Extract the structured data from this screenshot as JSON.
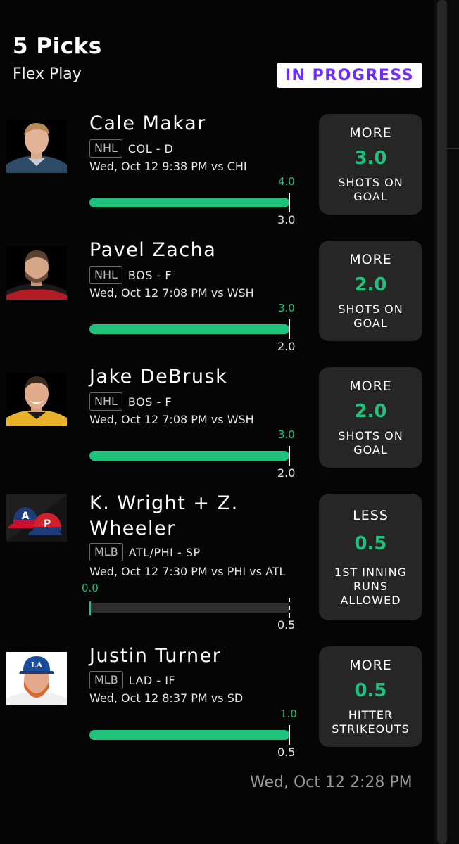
{
  "header": {
    "title": "5 Picks",
    "subtitle": "Flex Play",
    "status": "IN PROGRESS"
  },
  "colors": {
    "accent_green": "#1ec27a",
    "status_purple": "#6f2bff",
    "card_bg": "#262626"
  },
  "picks": [
    {
      "name": "Cale Makar",
      "league": "NHL",
      "team_pos": "COL - D",
      "game": "Wed, Oct 12 9:38 PM  vs CHI",
      "actual": "4.0",
      "target": "3.0",
      "progress": 1.0,
      "direction": "MORE",
      "line": "3.0",
      "stat": "SHOTS ON GOAL"
    },
    {
      "name": "Pavel Zacha",
      "league": "NHL",
      "team_pos": "BOS - F",
      "game": "Wed, Oct 12 7:08 PM  vs WSH",
      "actual": "3.0",
      "target": "2.0",
      "progress": 1.0,
      "direction": "MORE",
      "line": "2.0",
      "stat": "SHOTS ON GOAL"
    },
    {
      "name": "Jake DeBrusk",
      "league": "NHL",
      "team_pos": "BOS - F",
      "game": "Wed, Oct 12 7:08 PM  vs WSH",
      "actual": "3.0",
      "target": "2.0",
      "progress": 1.0,
      "direction": "MORE",
      "line": "2.0",
      "stat": "SHOTS ON GOAL"
    },
    {
      "name": "K. Wright + Z. Wheeler",
      "league": "MLB",
      "team_pos": "ATL/PHI - SP",
      "game": "Wed, Oct 12 7:30 PM  vs PHI vs ATL",
      "actual": "0.0",
      "target": "0.5",
      "progress": 0.0,
      "direction": "LESS",
      "line": "0.5",
      "stat": "1ST INNING RUNS ALLOWED",
      "avatar_icons": [
        "A",
        "P"
      ]
    },
    {
      "name": "Justin Turner",
      "league": "MLB",
      "team_pos": "LAD - IF",
      "game": "Wed, Oct 12 8:37 PM  vs SD",
      "actual": "1.0",
      "target": "0.5",
      "progress": 1.0,
      "direction": "MORE",
      "line": "0.5",
      "stat": "HITTER STRIKEOUTS",
      "avatar_icons": [
        "LA"
      ]
    }
  ],
  "footer": {
    "timestamp": "Wed, Oct 12 2:28 PM"
  }
}
